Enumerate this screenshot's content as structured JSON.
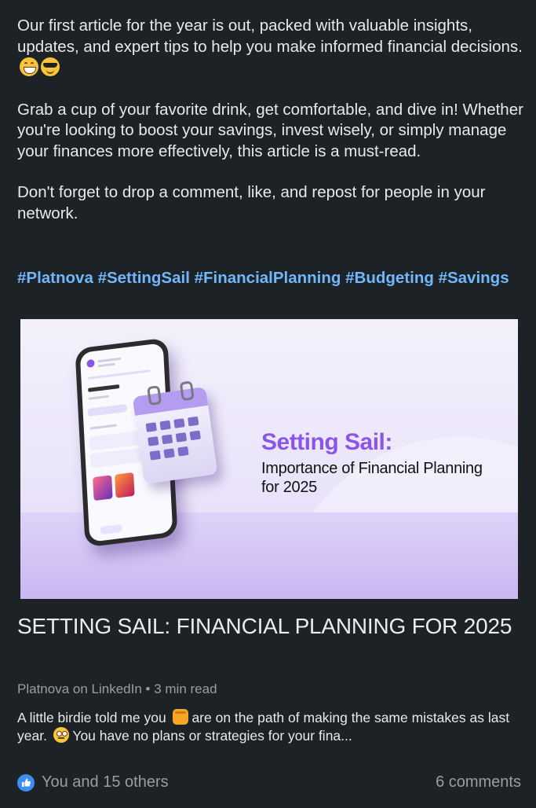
{
  "post": {
    "para1": "Our first article for the year is out, packed with valuable insights, updates, and expert tips to help you make informed financial decisions.",
    "para2": "Grab a cup of your favorite drink, get comfortable, and dive in! Whether you're looking to boost your savings, invest wisely, or simply manage your finances more effectively, this article is a must-read.",
    "para3": "Don't forget to drop a comment, like, and repost for people in your network.",
    "emojis": [
      "grinning-face-emoji",
      "sunglasses-face-emoji"
    ],
    "hashtags": [
      "#Platnova",
      "#SettingSail",
      "#FinancialPlanning",
      "#Budgeting",
      "#Savings"
    ]
  },
  "banner": {
    "headline": "Setting Sail:",
    "subline": "Importance of Financial Planning for 2025",
    "accent_color": "#8a55e8"
  },
  "article": {
    "title": "SETTING SAIL: FINANCIAL PLANNING FOR 2025",
    "source": "Platnova on LinkedIn",
    "separator": "•",
    "read_time": "3 min read",
    "desc_part1": "A little birdie told me you",
    "desc_part2": "are on the path of making the same mistakes as last year.",
    "desc_part3": "You have no plans or strategies for your fina..."
  },
  "footer": {
    "reactions": "You and 15 others",
    "comments": "6 comments",
    "like_color": "#3b8ff0"
  }
}
